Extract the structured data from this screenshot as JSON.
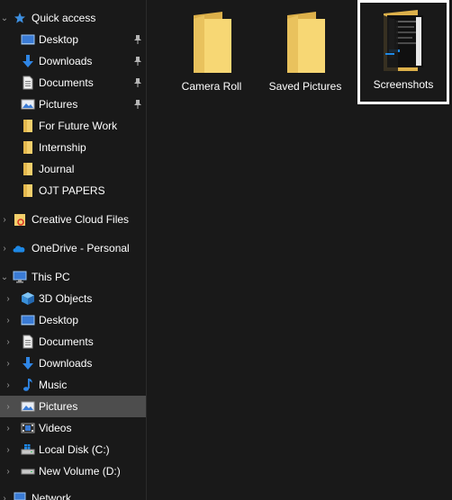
{
  "sidebar": {
    "quick_access": {
      "label": "Quick access",
      "items": [
        {
          "label": "Desktop",
          "icon": "desktop-icon",
          "pinned": true
        },
        {
          "label": "Downloads",
          "icon": "download-arrow-icon",
          "pinned": true
        },
        {
          "label": "Documents",
          "icon": "document-icon",
          "pinned": true
        },
        {
          "label": "Pictures",
          "icon": "pictures-icon",
          "pinned": true
        },
        {
          "label": "For Future Work",
          "icon": "folder-icon",
          "pinned": false
        },
        {
          "label": "Internship",
          "icon": "folder-icon",
          "pinned": false
        },
        {
          "label": "Journal",
          "icon": "folder-icon",
          "pinned": false
        },
        {
          "label": "OJT PAPERS",
          "icon": "folder-icon",
          "pinned": false
        }
      ]
    },
    "creative_cloud": {
      "label": "Creative Cloud Files"
    },
    "onedrive": {
      "label": "OneDrive - Personal"
    },
    "this_pc": {
      "label": "This PC",
      "items": [
        {
          "label": "3D Objects",
          "icon": "cube-icon"
        },
        {
          "label": "Desktop",
          "icon": "desktop-icon"
        },
        {
          "label": "Documents",
          "icon": "document-icon"
        },
        {
          "label": "Downloads",
          "icon": "download-arrow-icon"
        },
        {
          "label": "Music",
          "icon": "music-note-icon"
        },
        {
          "label": "Pictures",
          "icon": "pictures-icon",
          "selected": true
        },
        {
          "label": "Videos",
          "icon": "video-icon"
        },
        {
          "label": "Local Disk (C:)",
          "icon": "windows-drive-icon"
        },
        {
          "label": "New Volume (D:)",
          "icon": "drive-icon"
        }
      ]
    },
    "network": {
      "label": "Network"
    }
  },
  "folders": [
    {
      "label": "Camera Roll",
      "selected": false
    },
    {
      "label": "Saved Pictures",
      "selected": false
    },
    {
      "label": "Screenshots",
      "selected": true
    }
  ],
  "colors": {
    "background": "#191919",
    "selected_row": "#4d4d4d",
    "folder_front": "#f7d774",
    "folder_back": "#dcb04a",
    "accent_blue": "#1e88e5"
  }
}
